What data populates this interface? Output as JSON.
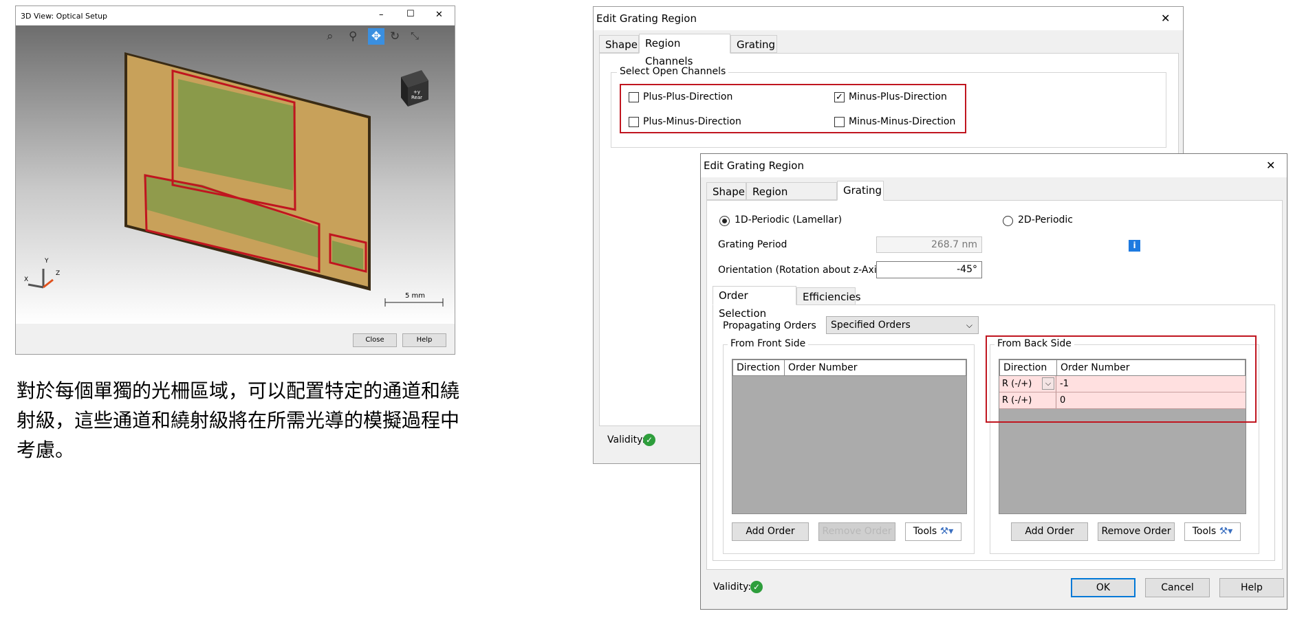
{
  "viewer": {
    "title": "3D View: Optical Setup",
    "min_label": "–",
    "max_label": "☐",
    "close_label": "✕",
    "scale_label": "5 mm",
    "axis_x": "X",
    "axis_y": "Y",
    "axis_z": "Z",
    "cube_label": "+y Rear",
    "close_button": "Close",
    "help_button": "Help",
    "toolbar_icons": [
      "zoom-region-icon",
      "zoom-icon",
      "pan-icon",
      "rotate-icon",
      "fit-icon"
    ]
  },
  "description": {
    "line1": "對於每個單獨的光柵區域，可以配置特定的通道和繞",
    "line2": "射級，這些通道和繞射級將在所需光導的模擬過程中",
    "line3": "考慮。"
  },
  "dialog_back": {
    "title": "Edit Grating Region",
    "close_label": "✕",
    "tabs": [
      "Shape",
      "Region Channels",
      "Grating"
    ],
    "active_tab": "Region Channels",
    "group_label": "Select Open Channels",
    "channels": [
      {
        "label": "Plus-Plus-Direction",
        "checked": false
      },
      {
        "label": "Minus-Plus-Direction",
        "checked": true
      },
      {
        "label": "Plus-Minus-Direction",
        "checked": false
      },
      {
        "label": "Minus-Minus-Direction",
        "checked": false
      }
    ],
    "check_mark": "✓",
    "validity_label": "Validity:",
    "validity_ok": "✓"
  },
  "dialog_front": {
    "title": "Edit Grating Region",
    "close_label": "✕",
    "tabs": [
      "Shape",
      "Region Channels",
      "Grating"
    ],
    "active_tab": "Grating",
    "periodic_1d": "1D-Periodic (Lamellar)",
    "periodic_2d": "2D-Periodic",
    "selected_periodic": "1D-Periodic (Lamellar)",
    "grating_period_label": "Grating Period",
    "grating_period_value": "268.7 nm",
    "orientation_label": "Orientation (Rotation about z-Axis)",
    "orientation_value": "-45°",
    "info_icon_glyph": "i",
    "subtabs": [
      "Order Selection",
      "Efficiencies"
    ],
    "active_subtab": "Order Selection",
    "propagating_label": "Propagating Orders",
    "propagating_value": "Specified Orders",
    "front_side": {
      "label": "From Front Side",
      "columns": [
        "Direction",
        "Order Number"
      ],
      "rows": [],
      "add_button": "Add Order",
      "remove_button": "Remove Order",
      "tools_button": "Tools"
    },
    "back_side": {
      "label": "From Back Side",
      "columns": [
        "Direction",
        "Order Number"
      ],
      "rows": [
        {
          "direction": "R (-/+)",
          "order": "-1"
        },
        {
          "direction": "R (-/+)",
          "order": "0"
        }
      ],
      "add_button": "Add Order",
      "remove_button": "Remove Order",
      "tools_button": "Tools"
    },
    "validity_label": "Validity:",
    "validity_ok": "✓",
    "ok_button": "OK",
    "cancel_button": "Cancel",
    "help_button": "Help"
  },
  "colors": {
    "highlight_red": "#c0151f",
    "row_highlight": "#ffe0e0",
    "validity_green": "#2e9e3c",
    "info_blue": "#1e7ae0",
    "plate_gold": "#c8a15a",
    "region_olive": "#8a9a4a"
  }
}
